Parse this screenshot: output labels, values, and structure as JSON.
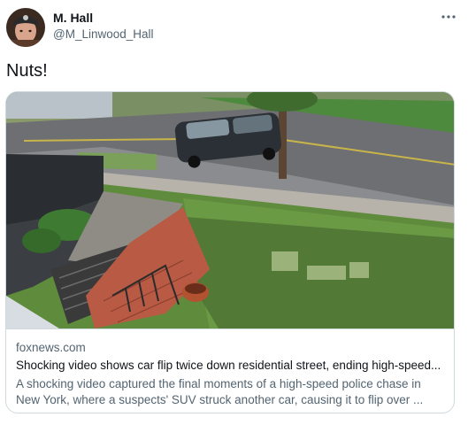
{
  "author": {
    "name": "M. Hall",
    "handle": "@M_Linwood_Hall"
  },
  "tweet": {
    "text": "Nuts!"
  },
  "link_card": {
    "domain": "foxnews.com",
    "title": "Shocking video shows car flip twice down residential street, ending high-speed...",
    "description": "A shocking video captured the final moments of a high-speed police chase in New York, where a suspects' SUV struck another car, causing it to flip over ..."
  },
  "icons": {
    "more": "more-horizontal-icon",
    "avatar": "user-avatar"
  },
  "colors": {
    "text_primary": "#0f1419",
    "text_secondary": "#536471",
    "border": "#cfd9de"
  }
}
